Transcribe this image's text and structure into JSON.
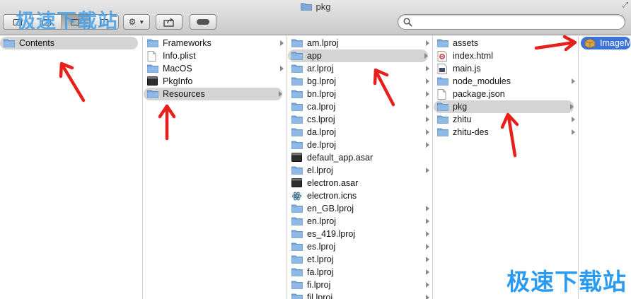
{
  "window": {
    "title": "pkg"
  },
  "watermark": {
    "top": "极速下载站",
    "bottom": "极速下载站"
  },
  "search": {
    "placeholder": ""
  },
  "columns": [
    {
      "items": [
        {
          "label": "Contents",
          "icon": "folder-icon",
          "selected": true,
          "arrow": false
        }
      ]
    },
    {
      "items": [
        {
          "label": "Frameworks",
          "icon": "folder-icon",
          "arrow": true
        },
        {
          "label": "Info.plist",
          "icon": "file-icon"
        },
        {
          "label": "MacOS",
          "icon": "folder-icon",
          "arrow": true
        },
        {
          "label": "PkgInfo",
          "icon": "exec-icon"
        },
        {
          "label": "Resources",
          "icon": "folder-icon",
          "arrow": true,
          "selected": true
        }
      ]
    },
    {
      "items": [
        {
          "label": "am.lproj",
          "icon": "folder-icon",
          "arrow": true
        },
        {
          "label": "app",
          "icon": "folder-icon",
          "arrow": true,
          "selected": true
        },
        {
          "label": "ar.lproj",
          "icon": "folder-icon",
          "arrow": true
        },
        {
          "label": "bg.lproj",
          "icon": "folder-icon",
          "arrow": true
        },
        {
          "label": "bn.lproj",
          "icon": "folder-icon",
          "arrow": true
        },
        {
          "label": "ca.lproj",
          "icon": "folder-icon",
          "arrow": true
        },
        {
          "label": "cs.lproj",
          "icon": "folder-icon",
          "arrow": true
        },
        {
          "label": "da.lproj",
          "icon": "folder-icon",
          "arrow": true
        },
        {
          "label": "de.lproj",
          "icon": "folder-icon",
          "arrow": true
        },
        {
          "label": "default_app.asar",
          "icon": "exec-icon"
        },
        {
          "label": "el.lproj",
          "icon": "folder-icon",
          "arrow": true
        },
        {
          "label": "electron.asar",
          "icon": "exec-icon"
        },
        {
          "label": "electron.icns",
          "icon": "electron-icon"
        },
        {
          "label": "en_GB.lproj",
          "icon": "folder-icon",
          "arrow": true
        },
        {
          "label": "en.lproj",
          "icon": "folder-icon",
          "arrow": true
        },
        {
          "label": "es_419.lproj",
          "icon": "folder-icon",
          "arrow": true
        },
        {
          "label": "es.lproj",
          "icon": "folder-icon",
          "arrow": true
        },
        {
          "label": "et.lproj",
          "icon": "folder-icon",
          "arrow": true
        },
        {
          "label": "fa.lproj",
          "icon": "folder-icon",
          "arrow": true
        },
        {
          "label": "fi.lproj",
          "icon": "folder-icon",
          "arrow": true
        },
        {
          "label": "fil.lproj",
          "icon": "folder-icon",
          "arrow": true
        }
      ]
    },
    {
      "items": [
        {
          "label": "assets",
          "icon": "folder-icon",
          "arrow": true
        },
        {
          "label": "index.html",
          "icon": "chrome-icon"
        },
        {
          "label": "main.js",
          "icon": "script-icon"
        },
        {
          "label": "node_modules",
          "icon": "folder-icon",
          "arrow": true
        },
        {
          "label": "package.json",
          "icon": "file-icon"
        },
        {
          "label": "pkg",
          "icon": "folder-icon",
          "arrow": true,
          "selected": true
        },
        {
          "label": "zhitu",
          "icon": "folder-icon",
          "arrow": true
        },
        {
          "label": "zhitu-des",
          "icon": "folder-icon",
          "arrow": true
        }
      ]
    },
    {
      "items": [
        {
          "label": "ImageM",
          "icon": "package-icon",
          "selectedBlue": true
        }
      ]
    }
  ],
  "colors": {
    "folder": "#6fa3d8",
    "selection": "#d4d4d4",
    "selection_active": "#3b73d6",
    "annotation": "#e8201c"
  }
}
